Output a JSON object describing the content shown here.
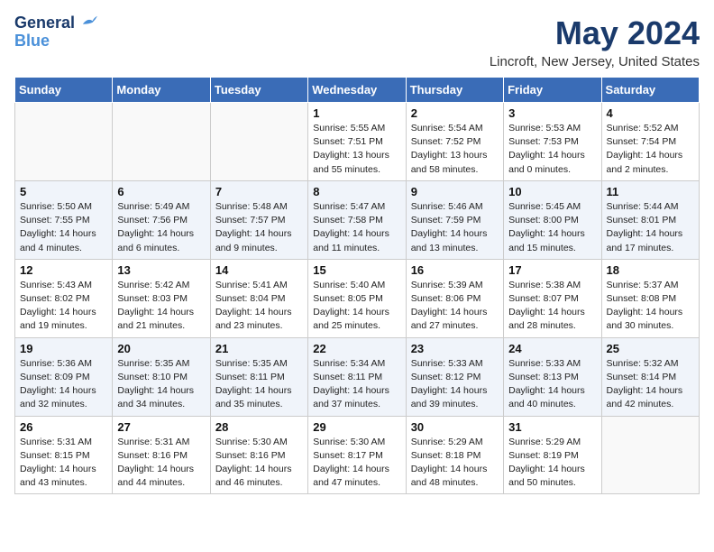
{
  "header": {
    "logo_line1": "General",
    "logo_line2": "Blue",
    "title": "May 2024",
    "subtitle": "Lincroft, New Jersey, United States"
  },
  "days_of_week": [
    "Sunday",
    "Monday",
    "Tuesday",
    "Wednesday",
    "Thursday",
    "Friday",
    "Saturday"
  ],
  "weeks": [
    [
      {
        "day": "",
        "info": ""
      },
      {
        "day": "",
        "info": ""
      },
      {
        "day": "",
        "info": ""
      },
      {
        "day": "1",
        "info": "Sunrise: 5:55 AM\nSunset: 7:51 PM\nDaylight: 13 hours\nand 55 minutes."
      },
      {
        "day": "2",
        "info": "Sunrise: 5:54 AM\nSunset: 7:52 PM\nDaylight: 13 hours\nand 58 minutes."
      },
      {
        "day": "3",
        "info": "Sunrise: 5:53 AM\nSunset: 7:53 PM\nDaylight: 14 hours\nand 0 minutes."
      },
      {
        "day": "4",
        "info": "Sunrise: 5:52 AM\nSunset: 7:54 PM\nDaylight: 14 hours\nand 2 minutes."
      }
    ],
    [
      {
        "day": "5",
        "info": "Sunrise: 5:50 AM\nSunset: 7:55 PM\nDaylight: 14 hours\nand 4 minutes."
      },
      {
        "day": "6",
        "info": "Sunrise: 5:49 AM\nSunset: 7:56 PM\nDaylight: 14 hours\nand 6 minutes."
      },
      {
        "day": "7",
        "info": "Sunrise: 5:48 AM\nSunset: 7:57 PM\nDaylight: 14 hours\nand 9 minutes."
      },
      {
        "day": "8",
        "info": "Sunrise: 5:47 AM\nSunset: 7:58 PM\nDaylight: 14 hours\nand 11 minutes."
      },
      {
        "day": "9",
        "info": "Sunrise: 5:46 AM\nSunset: 7:59 PM\nDaylight: 14 hours\nand 13 minutes."
      },
      {
        "day": "10",
        "info": "Sunrise: 5:45 AM\nSunset: 8:00 PM\nDaylight: 14 hours\nand 15 minutes."
      },
      {
        "day": "11",
        "info": "Sunrise: 5:44 AM\nSunset: 8:01 PM\nDaylight: 14 hours\nand 17 minutes."
      }
    ],
    [
      {
        "day": "12",
        "info": "Sunrise: 5:43 AM\nSunset: 8:02 PM\nDaylight: 14 hours\nand 19 minutes."
      },
      {
        "day": "13",
        "info": "Sunrise: 5:42 AM\nSunset: 8:03 PM\nDaylight: 14 hours\nand 21 minutes."
      },
      {
        "day": "14",
        "info": "Sunrise: 5:41 AM\nSunset: 8:04 PM\nDaylight: 14 hours\nand 23 minutes."
      },
      {
        "day": "15",
        "info": "Sunrise: 5:40 AM\nSunset: 8:05 PM\nDaylight: 14 hours\nand 25 minutes."
      },
      {
        "day": "16",
        "info": "Sunrise: 5:39 AM\nSunset: 8:06 PM\nDaylight: 14 hours\nand 27 minutes."
      },
      {
        "day": "17",
        "info": "Sunrise: 5:38 AM\nSunset: 8:07 PM\nDaylight: 14 hours\nand 28 minutes."
      },
      {
        "day": "18",
        "info": "Sunrise: 5:37 AM\nSunset: 8:08 PM\nDaylight: 14 hours\nand 30 minutes."
      }
    ],
    [
      {
        "day": "19",
        "info": "Sunrise: 5:36 AM\nSunset: 8:09 PM\nDaylight: 14 hours\nand 32 minutes."
      },
      {
        "day": "20",
        "info": "Sunrise: 5:35 AM\nSunset: 8:10 PM\nDaylight: 14 hours\nand 34 minutes."
      },
      {
        "day": "21",
        "info": "Sunrise: 5:35 AM\nSunset: 8:11 PM\nDaylight: 14 hours\nand 35 minutes."
      },
      {
        "day": "22",
        "info": "Sunrise: 5:34 AM\nSunset: 8:11 PM\nDaylight: 14 hours\nand 37 minutes."
      },
      {
        "day": "23",
        "info": "Sunrise: 5:33 AM\nSunset: 8:12 PM\nDaylight: 14 hours\nand 39 minutes."
      },
      {
        "day": "24",
        "info": "Sunrise: 5:33 AM\nSunset: 8:13 PM\nDaylight: 14 hours\nand 40 minutes."
      },
      {
        "day": "25",
        "info": "Sunrise: 5:32 AM\nSunset: 8:14 PM\nDaylight: 14 hours\nand 42 minutes."
      }
    ],
    [
      {
        "day": "26",
        "info": "Sunrise: 5:31 AM\nSunset: 8:15 PM\nDaylight: 14 hours\nand 43 minutes."
      },
      {
        "day": "27",
        "info": "Sunrise: 5:31 AM\nSunset: 8:16 PM\nDaylight: 14 hours\nand 44 minutes."
      },
      {
        "day": "28",
        "info": "Sunrise: 5:30 AM\nSunset: 8:16 PM\nDaylight: 14 hours\nand 46 minutes."
      },
      {
        "day": "29",
        "info": "Sunrise: 5:30 AM\nSunset: 8:17 PM\nDaylight: 14 hours\nand 47 minutes."
      },
      {
        "day": "30",
        "info": "Sunrise: 5:29 AM\nSunset: 8:18 PM\nDaylight: 14 hours\nand 48 minutes."
      },
      {
        "day": "31",
        "info": "Sunrise: 5:29 AM\nSunset: 8:19 PM\nDaylight: 14 hours\nand 50 minutes."
      },
      {
        "day": "",
        "info": ""
      }
    ]
  ]
}
